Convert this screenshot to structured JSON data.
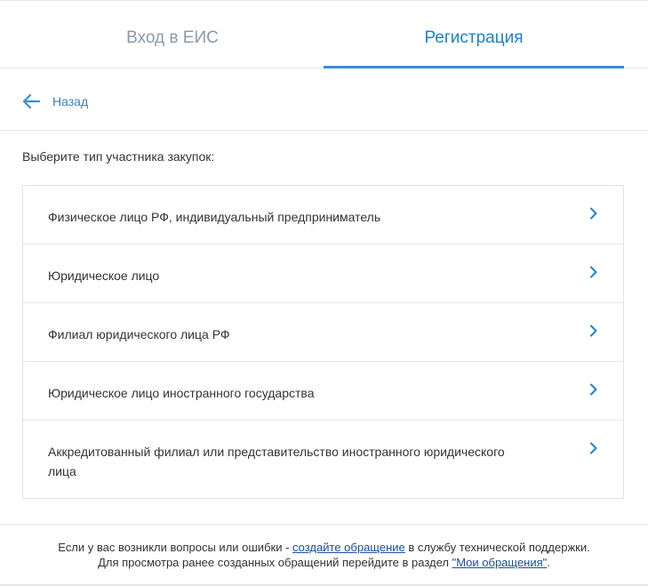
{
  "tabs": {
    "login_label": "Вход в ЕИС",
    "register_label": "Регистрация",
    "active": "register"
  },
  "back": {
    "label": "Назад",
    "icon": "arrow-left-icon"
  },
  "prompt": "Выберите тип участника закупок:",
  "participant_types": [
    {
      "label": "Физическое лицо РФ, индивидуальный предприниматель",
      "icon": "chevron-right-icon"
    },
    {
      "label": "Юридическое лицо",
      "icon": "chevron-right-icon"
    },
    {
      "label": "Филиал юридического лица РФ",
      "icon": "chevron-right-icon"
    },
    {
      "label": "Юридическое лицо иностранного государства",
      "icon": "chevron-right-icon"
    },
    {
      "label": "Аккредитованный филиал или представительство иностранного юридического лица",
      "icon": "chevron-right-icon"
    }
  ],
  "footer": {
    "line1_before": "Если у вас возникли вопросы или ошибки - ",
    "line1_link": "создайте обращение",
    "line1_after": " в службу технической поддержки.",
    "line2_before": "Для просмотра ранее созданных обращений перейдите в раздел ",
    "line2_link": "\"Мои обращения\"",
    "line2_after": "."
  },
  "colors": {
    "accent": "#1a82d6",
    "inactive_tab": "#8a9aab",
    "link": "#1a4fa3",
    "border": "#e3e6ea"
  }
}
